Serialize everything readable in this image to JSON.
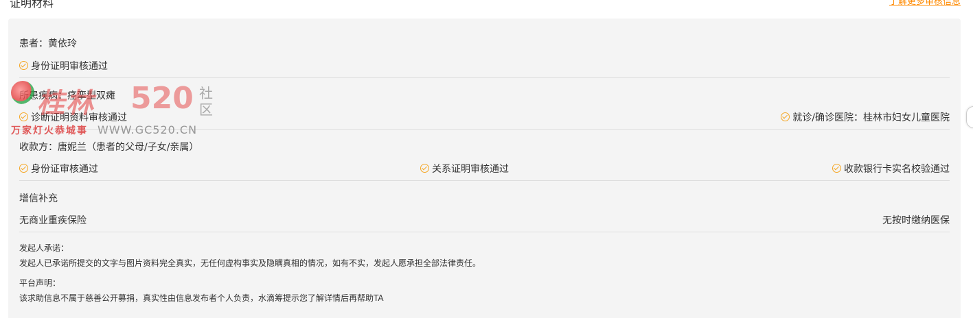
{
  "header": {
    "title": "证明材料",
    "more_link": "了解更多审核信息"
  },
  "patient": {
    "label": "患者：黄依玲",
    "id_status": "身份证明审核通过"
  },
  "disease": {
    "label": "所患疾病：痉挛型双瘫",
    "diagnosis_status": "诊断证明资料审核通过",
    "hospital_status": "就诊/确诊医院：桂林市妇女儿童医院"
  },
  "payee": {
    "label": "收款方：唐妮兰（患者的父母/子女/亲属）",
    "id_status": "身份证审核通过",
    "relation_status": "关系证明审核通过",
    "bank_status": "收款银行卡实名校验通过"
  },
  "credit": {
    "title": "增信补充",
    "insurance": "无商业重疾保险",
    "medical": "无按时缴纳医保"
  },
  "promise": {
    "title": "发起人承诺：",
    "text": "发起人已承诺所提交的文字与图片资料完全真实，无任何虚构事实及隐瞒真相的情况，如有不实，发起人愿承担全部法律责任。"
  },
  "statement": {
    "title": "平台声明：",
    "text": "该求助信息不属于慈善公开募捐，真实性由信息发布者个人负责，水滴筹提示您了解详情后再帮助TA"
  },
  "watermark": {
    "logo": "桂林",
    "num": "520",
    "she": "社区",
    "slogan": "万家灯火恭城事",
    "url": "WWW.GC520.CN"
  },
  "colors": {
    "accent": "#ff8a00",
    "check": "#f5a623",
    "panel_bg": "#f4f4f4"
  },
  "icons": {
    "status": "check-circle-icon"
  }
}
